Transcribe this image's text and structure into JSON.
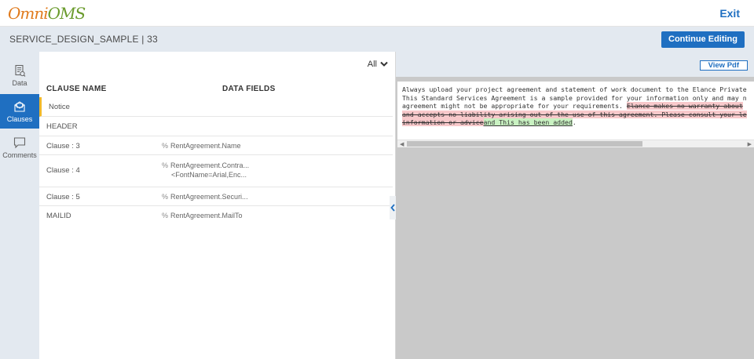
{
  "header": {
    "logo": {
      "part1": "Omni",
      "part2": "OMS"
    },
    "exit_label": "Exit"
  },
  "subbar": {
    "title": "SERVICE_DESIGN_SAMPLE | 33",
    "continue_label": "Continue Editing"
  },
  "sidenav": {
    "items": [
      {
        "label": "Data",
        "icon": "data-icon",
        "active": false
      },
      {
        "label": "Clauses",
        "icon": "clauses-icon",
        "active": true
      },
      {
        "label": "Comments",
        "icon": "comment-icon",
        "active": false
      }
    ]
  },
  "clauses": {
    "filter_label": "All",
    "col_name": "CLAUSE NAME",
    "col_fields": "DATA FIELDS",
    "rows": [
      {
        "name": "Notice",
        "field_1": "",
        "field_2": "",
        "selected": true
      },
      {
        "name": "HEADER",
        "field_1": "",
        "field_2": ""
      },
      {
        "name": "Clause : 3",
        "field_1": "RentAgreement.Name",
        "field_2": ""
      },
      {
        "name": "Clause : 4",
        "field_1": "RentAgreement.Contra...",
        "field_2": "<FontName=Arial,Enc..."
      },
      {
        "name": "Clause : 5",
        "field_1": "RentAgreement.Securi...",
        "field_2": ""
      },
      {
        "name": "MAILID",
        "field_1": "RentAgreement.MailTo",
        "field_2": ""
      }
    ]
  },
  "preview": {
    "viewpdf_label": "View Pdf",
    "line1": "Always upload your project agreement and statement of work document to the Elance Private",
    "line2": "This Standard Services Agreement is a sample provided for your information only and may n",
    "line3_plain": "agreement might not be appropriate for your requirements. ",
    "line3_del": "Elance makes no warranty about",
    "line4_del": "and accepts no liability arising out of the use of this agreement. Please consult your le",
    "line5_del": "information or advice",
    "line5_ins": "and This has been added",
    "line5_end": "."
  },
  "colors": {
    "accent": "#1f6fc1",
    "selected_marker": "#f0b829",
    "deleted_bg": "#f8c9cb",
    "inserted_bg": "#c9f2c2"
  }
}
